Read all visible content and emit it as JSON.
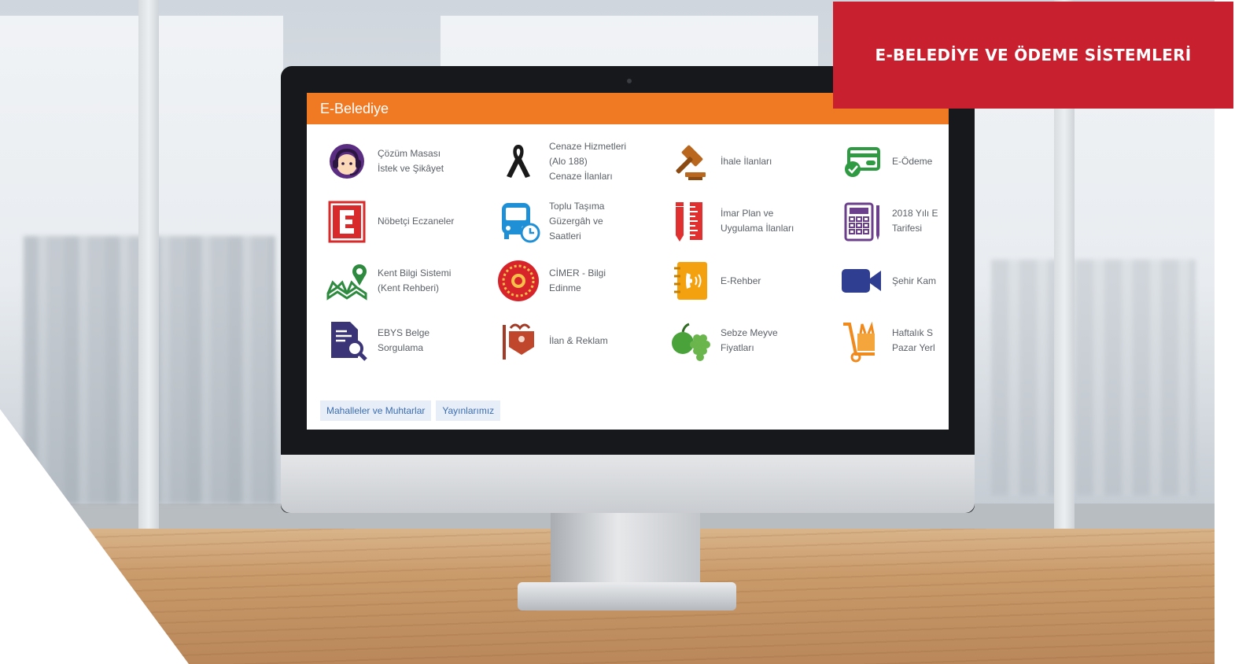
{
  "banner": {
    "title": "E-BELEDİYE VE ÖDEME SİSTEMLERİ"
  },
  "screen": {
    "title": "E-Belediye",
    "tiles": [
      {
        "lines": [
          "Çözüm Masası",
          "İstek ve Şikâyet"
        ],
        "icon": "headset-support-icon"
      },
      {
        "lines": [
          "Cenaze Hizmetleri",
          "(Alo 188)",
          "Cenaze İlanları"
        ],
        "icon": "mourning-ribbon-icon"
      },
      {
        "lines": [
          "İhale İlanları"
        ],
        "icon": "auction-gavel-icon"
      },
      {
        "lines": [
          "E-Ödeme"
        ],
        "icon": "payment-card-icon"
      },
      {
        "lines": [
          "Nöbetçi Eczaneler"
        ],
        "icon": "pharmacy-e-icon"
      },
      {
        "lines": [
          "Toplu Taşıma",
          "Güzergâh ve",
          "Saatleri"
        ],
        "icon": "bus-clock-icon"
      },
      {
        "lines": [
          "İmar Plan ve",
          "Uygulama İlanları"
        ],
        "icon": "ruler-pencil-icon"
      },
      {
        "lines": [
          "2018 Yılı E",
          "Tarifesi"
        ],
        "icon": "calculator-icon"
      },
      {
        "lines": [
          "Kent Bilgi Sistemi",
          "(Kent Rehberi)"
        ],
        "icon": "map-pin-icon"
      },
      {
        "lines": [
          "CİMER - Bilgi",
          "Edinme"
        ],
        "icon": "cimer-seal-icon"
      },
      {
        "lines": [
          "E-Rehber"
        ],
        "icon": "phone-book-icon"
      },
      {
        "lines": [
          "Şehir Kam"
        ],
        "icon": "video-camera-icon"
      },
      {
        "lines": [
          "EBYS Belge",
          "Sorgulama"
        ],
        "icon": "document-search-icon"
      },
      {
        "lines": [
          "İlan & Reklam"
        ],
        "icon": "billboard-icon"
      },
      {
        "lines": [
          "Sebze Meyve",
          "Fiyatları"
        ],
        "icon": "fruits-vegetables-icon"
      },
      {
        "lines": [
          "Haftalık S",
          "Pazar Yerl"
        ],
        "icon": "hand-truck-icon"
      }
    ],
    "links": [
      "Mahalleler ve Muhtarlar",
      "Yayınlarımız"
    ]
  },
  "colors": {
    "accent": "#f07a24",
    "banner": "#c8202f",
    "link": "#3c6db0"
  }
}
